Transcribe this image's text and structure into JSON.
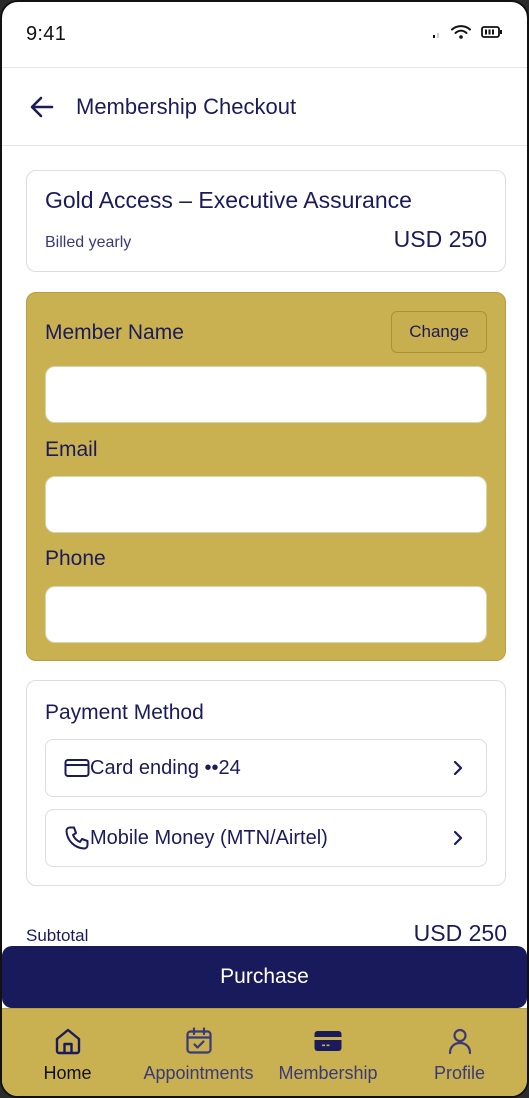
{
  "status_bar": {
    "time": "9:41"
  },
  "header": {
    "title": "Membership Checkout"
  },
  "plan": {
    "title": "Gold Access – Executive Assurance",
    "billing": "Billed yearly",
    "price": "USD 250"
  },
  "member_form": {
    "name_label": "Member Name",
    "change_label": "Change",
    "name_value": "",
    "email_label": "Email",
    "email_value": "",
    "phone_label": "Phone",
    "phone_value": ""
  },
  "payment": {
    "title": "Payment Method",
    "options": [
      {
        "label": "Card ending ••24",
        "icon": "credit-card-icon"
      },
      {
        "label": "Mobile Money (MTN/Airtel)",
        "icon": "phone-icon"
      }
    ]
  },
  "summary": {
    "subtotal_label": "Subtotal",
    "subtotal_value": "USD 250"
  },
  "purchase_label": "Purchase",
  "nav": {
    "active": "Home",
    "items": [
      {
        "label": "Home",
        "icon": "home-icon"
      },
      {
        "label": "Appointments",
        "icon": "calendar-icon"
      },
      {
        "label": "Membership",
        "icon": "membership-card-icon"
      },
      {
        "label": "Profile",
        "icon": "user-icon"
      }
    ]
  },
  "colors": {
    "brand_navy": "#191a5b",
    "brand_gold": "#c9b050",
    "text": "#1b1b5c"
  }
}
